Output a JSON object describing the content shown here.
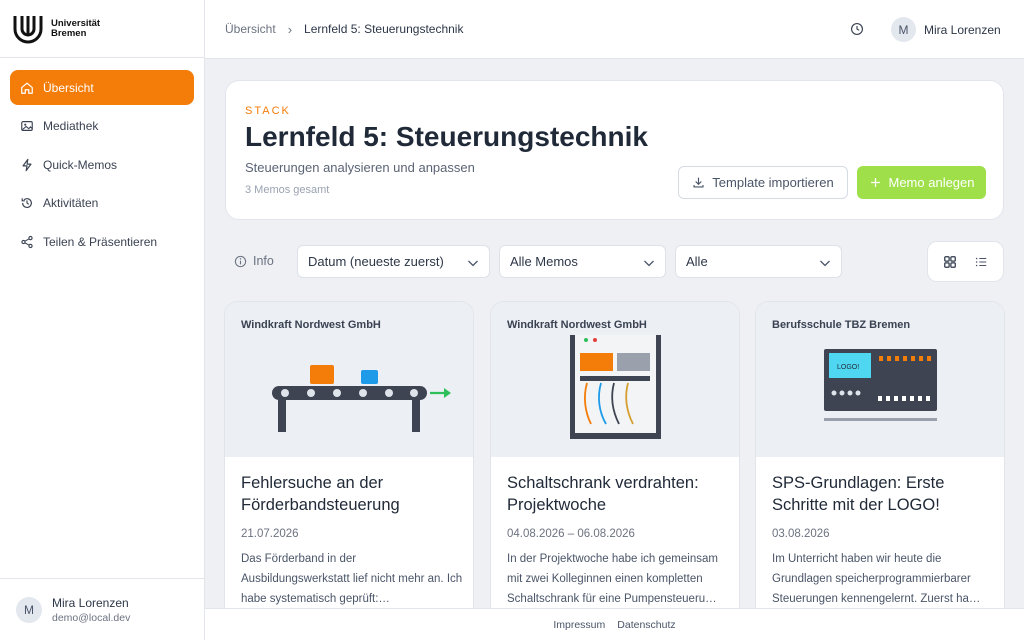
{
  "brand": {
    "name_line1": "Universität",
    "name_line2": "Bremen"
  },
  "nav": {
    "items": [
      {
        "label": "Übersicht",
        "icon": "home-icon",
        "active": true
      },
      {
        "label": "Mediathek",
        "icon": "images-icon"
      },
      {
        "label": "Quick-Memos",
        "icon": "lightning-icon"
      },
      {
        "label": "Aktivitäten",
        "icon": "history-icon"
      },
      {
        "label": "Teilen & Präsentieren",
        "icon": "share-icon"
      }
    ]
  },
  "user": {
    "initial": "M",
    "name": "Mira Lorenzen",
    "email": "demo@local.dev"
  },
  "breadcrumb": {
    "root": "Übersicht",
    "separator": "›",
    "current": "Lernfeld 5: Steuerungstechnik"
  },
  "stack": {
    "label": "STACK",
    "title": "Lernfeld 5: Steuerungstechnik",
    "subtitle": "Steuerungen analysieren und anpassen",
    "count": "3 Memos gesamt"
  },
  "actions": {
    "import_label": "Template importieren",
    "new_label": "Memo anlegen"
  },
  "filters": {
    "info_label": "Info",
    "sort": "Datum (neueste zuerst)",
    "type": "Alle Memos",
    "scope": "Alle"
  },
  "cards": [
    {
      "company": "Windkraft Nordwest GmbH",
      "title": "Fehlersuche an der Förderbandsteuerung",
      "date": "21.07.2026",
      "excerpt": "Das Förderband in der Ausbildungswerkstatt lief nicht mehr an. Ich habe systematisch geprüft:…"
    },
    {
      "company": "Windkraft Nordwest GmbH",
      "title": "Schaltschrank verdrahten: Projektwoche",
      "date": "04.08.2026 – 06.08.2026",
      "excerpt": "In der Projektwoche habe ich gemeinsam mit zwei Kolleginnen einen kompletten Schaltschrank für eine Pumpensteueru…"
    },
    {
      "company": "Berufsschule TBZ Bremen",
      "title": "SPS-Grundlagen: Erste Schritte mit der LOGO!",
      "date": "03.08.2026",
      "excerpt": "Im Unterricht haben wir heute die Grundlagen speicherprogrammierbarer Steuerungen kennengelernt. Zuerst ha…",
      "art_text": "LOGO!"
    }
  ],
  "footer": {
    "impressum": "Impressum",
    "datenschutz": "Datenschutz"
  },
  "colors": {
    "accent": "#f47c08",
    "primary_button": "#9fe04a"
  }
}
